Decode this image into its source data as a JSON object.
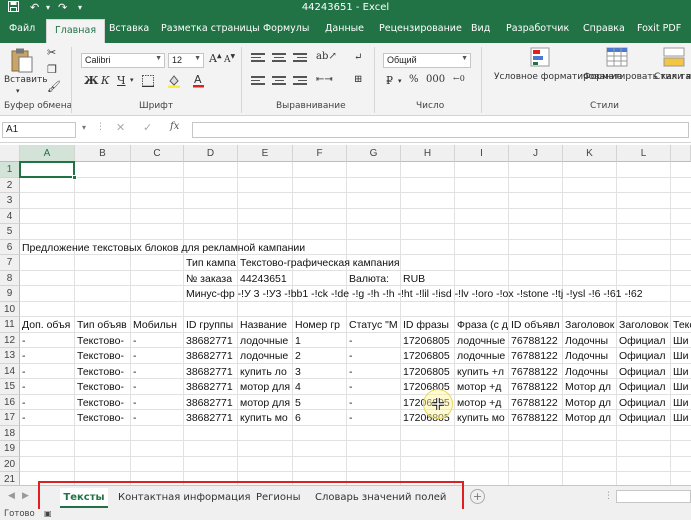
{
  "window": {
    "title": "44243651 - Excel"
  },
  "ribbon": {
    "tabs": [
      {
        "label": "Файл"
      },
      {
        "label": "Главная"
      },
      {
        "label": "Вставка"
      },
      {
        "label": "Разметка страницы"
      },
      {
        "label": "Формулы"
      },
      {
        "label": "Данные"
      },
      {
        "label": "Рецензирование"
      },
      {
        "label": "Вид"
      },
      {
        "label": "Разработчик"
      },
      {
        "label": "Справка"
      },
      {
        "label": "Foxit PDF"
      }
    ],
    "active_tab": "Главная",
    "paste_label": "Вставить",
    "font_name": "Calibri",
    "font_size": "12",
    "number_format": "Общий",
    "bold": "Ж",
    "italic": "К",
    "underline": "Ч",
    "currency_symbol": "₽",
    "cond_format_label": "Условное форматирование",
    "format_table_label": "Форматировать как таблицу",
    "cell_styles_label": "Стили ячеек",
    "groups": {
      "clipboard": "Буфер обмена",
      "font": "Шрифт",
      "alignment": "Выравнивание",
      "number": "Число",
      "styles": "Стили"
    }
  },
  "formula_bar": {
    "name_box": "A1",
    "fx": "fx",
    "value": ""
  },
  "grid": {
    "columns": [
      "A",
      "B",
      "C",
      "D",
      "E",
      "F",
      "G",
      "H",
      "I",
      "J",
      "K",
      "L"
    ],
    "rows": [
      "1",
      "2",
      "3",
      "4",
      "5",
      "6",
      "7",
      "8",
      "9",
      "10",
      "11",
      "12",
      "13",
      "14",
      "15",
      "16",
      "17",
      "18",
      "19",
      "20",
      "21"
    ],
    "cells": [
      {
        "row": 6,
        "col": "A",
        "text": "Предложение текстовых блоков для рекламной кампании"
      },
      {
        "row": 7,
        "col": "D",
        "text": "Тип кампа"
      },
      {
        "row": 7,
        "col": "E",
        "text": "Текстово-графическая кампания"
      },
      {
        "row": 8,
        "col": "D",
        "text": "№ заказа"
      },
      {
        "row": 8,
        "col": "E",
        "text": "44243651"
      },
      {
        "row": 8,
        "col": "G",
        "text": "Валюта:"
      },
      {
        "row": 8,
        "col": "H",
        "text": "RUB"
      },
      {
        "row": 9,
        "col": "D",
        "text": "Минус-фр -!У 3 -!У3 -!bb1 -!ck -!de -!g -!h -!h -!ht -!lil -!isd -!lv -!oro -!ox -!stone -!tj -!ysl -!6 -!61 -!62"
      },
      {
        "row": 11,
        "col": "A",
        "text": "Доп. объя"
      },
      {
        "row": 11,
        "col": "B",
        "text": "Тип объяв"
      },
      {
        "row": 11,
        "col": "C",
        "text": "Мобильн"
      },
      {
        "row": 11,
        "col": "D",
        "text": "ID группы"
      },
      {
        "row": 11,
        "col": "E",
        "text": "Название"
      },
      {
        "row": 11,
        "col": "F",
        "text": "Номер гр"
      },
      {
        "row": 11,
        "col": "G",
        "text": "Статус \"М"
      },
      {
        "row": 11,
        "col": "H",
        "text": "ID фразы"
      },
      {
        "row": 11,
        "col": "I",
        "text": "Фраза (с д"
      },
      {
        "row": 11,
        "col": "J",
        "text": "ID объявл"
      },
      {
        "row": 11,
        "col": "K",
        "text": "Заголовок"
      },
      {
        "row": 11,
        "col": "L",
        "text": "Заголовок"
      },
      {
        "row": 11,
        "col": "M",
        "text": "Текс"
      },
      {
        "row": 12,
        "col": "A",
        "text": "-"
      },
      {
        "row": 12,
        "col": "B",
        "text": "Текстово-"
      },
      {
        "row": 12,
        "col": "C",
        "text": "-"
      },
      {
        "row": 12,
        "col": "D",
        "text": "38682771"
      },
      {
        "row": 12,
        "col": "E",
        "text": "лодочные"
      },
      {
        "row": 12,
        "col": "F",
        "text": "1"
      },
      {
        "row": 12,
        "col": "G",
        "text": "-"
      },
      {
        "row": 12,
        "col": "H",
        "text": "17206805"
      },
      {
        "row": 12,
        "col": "I",
        "text": "лодочные"
      },
      {
        "row": 12,
        "col": "J",
        "text": "76788122"
      },
      {
        "row": 12,
        "col": "K",
        "text": "Лодочны"
      },
      {
        "row": 12,
        "col": "L",
        "text": "Официал"
      },
      {
        "row": 12,
        "col": "M",
        "text": "Ши"
      },
      {
        "row": 13,
        "col": "A",
        "text": "-"
      },
      {
        "row": 13,
        "col": "B",
        "text": "Текстово-"
      },
      {
        "row": 13,
        "col": "C",
        "text": "-"
      },
      {
        "row": 13,
        "col": "D",
        "text": "38682771"
      },
      {
        "row": 13,
        "col": "E",
        "text": "лодочные"
      },
      {
        "row": 13,
        "col": "F",
        "text": "2"
      },
      {
        "row": 13,
        "col": "G",
        "text": "-"
      },
      {
        "row": 13,
        "col": "H",
        "text": "17206805"
      },
      {
        "row": 13,
        "col": "I",
        "text": "лодочные"
      },
      {
        "row": 13,
        "col": "J",
        "text": "76788122"
      },
      {
        "row": 13,
        "col": "K",
        "text": "Лодочны"
      },
      {
        "row": 13,
        "col": "L",
        "text": "Официал"
      },
      {
        "row": 13,
        "col": "M",
        "text": "Ши"
      },
      {
        "row": 14,
        "col": "A",
        "text": "-"
      },
      {
        "row": 14,
        "col": "B",
        "text": "Текстово-"
      },
      {
        "row": 14,
        "col": "C",
        "text": "-"
      },
      {
        "row": 14,
        "col": "D",
        "text": "38682771"
      },
      {
        "row": 14,
        "col": "E",
        "text": "купить ло"
      },
      {
        "row": 14,
        "col": "F",
        "text": "3"
      },
      {
        "row": 14,
        "col": "G",
        "text": "-"
      },
      {
        "row": 14,
        "col": "H",
        "text": "17206805"
      },
      {
        "row": 14,
        "col": "I",
        "text": "купить +л"
      },
      {
        "row": 14,
        "col": "J",
        "text": "76788122"
      },
      {
        "row": 14,
        "col": "K",
        "text": "Лодочны"
      },
      {
        "row": 14,
        "col": "L",
        "text": "Официал"
      },
      {
        "row": 14,
        "col": "M",
        "text": "Ши"
      },
      {
        "row": 15,
        "col": "A",
        "text": "-"
      },
      {
        "row": 15,
        "col": "B",
        "text": "Текстово-"
      },
      {
        "row": 15,
        "col": "C",
        "text": "-"
      },
      {
        "row": 15,
        "col": "D",
        "text": "38682771"
      },
      {
        "row": 15,
        "col": "E",
        "text": "мотор для"
      },
      {
        "row": 15,
        "col": "F",
        "text": "4"
      },
      {
        "row": 15,
        "col": "G",
        "text": "-"
      },
      {
        "row": 15,
        "col": "H",
        "text": "17206805"
      },
      {
        "row": 15,
        "col": "I",
        "text": "мотор +д"
      },
      {
        "row": 15,
        "col": "J",
        "text": "76788122"
      },
      {
        "row": 15,
        "col": "K",
        "text": "Мотор дл"
      },
      {
        "row": 15,
        "col": "L",
        "text": "Официал"
      },
      {
        "row": 15,
        "col": "M",
        "text": "Ши"
      },
      {
        "row": 16,
        "col": "A",
        "text": "-"
      },
      {
        "row": 16,
        "col": "B",
        "text": "Текстово-"
      },
      {
        "row": 16,
        "col": "C",
        "text": "-"
      },
      {
        "row": 16,
        "col": "D",
        "text": "38682771"
      },
      {
        "row": 16,
        "col": "E",
        "text": "мотор для"
      },
      {
        "row": 16,
        "col": "F",
        "text": "5"
      },
      {
        "row": 16,
        "col": "G",
        "text": "-"
      },
      {
        "row": 16,
        "col": "H",
        "text": "17206805"
      },
      {
        "row": 16,
        "col": "I",
        "text": "мотор +д"
      },
      {
        "row": 16,
        "col": "J",
        "text": "76788122"
      },
      {
        "row": 16,
        "col": "K",
        "text": "Мотор дл"
      },
      {
        "row": 16,
        "col": "L",
        "text": "Официал"
      },
      {
        "row": 16,
        "col": "M",
        "text": "Ши"
      },
      {
        "row": 17,
        "col": "A",
        "text": "-"
      },
      {
        "row": 17,
        "col": "B",
        "text": "Текстово-"
      },
      {
        "row": 17,
        "col": "C",
        "text": "-"
      },
      {
        "row": 17,
        "col": "D",
        "text": "38682771"
      },
      {
        "row": 17,
        "col": "E",
        "text": "купить мо"
      },
      {
        "row": 17,
        "col": "F",
        "text": "6"
      },
      {
        "row": 17,
        "col": "G",
        "text": "-"
      },
      {
        "row": 17,
        "col": "H",
        "text": "17206805"
      },
      {
        "row": 17,
        "col": "I",
        "text": "купить мо"
      },
      {
        "row": 17,
        "col": "J",
        "text": "76788122"
      },
      {
        "row": 17,
        "col": "K",
        "text": "Мотор дл"
      },
      {
        "row": 17,
        "col": "L",
        "text": "Официал"
      },
      {
        "row": 17,
        "col": "M",
        "text": "Ши"
      }
    ]
  },
  "sheets": [
    {
      "label": "Тексты",
      "active": true
    },
    {
      "label": "Контактная информация",
      "active": false
    },
    {
      "label": "Регионы",
      "active": false
    },
    {
      "label": "Словарь значений полей",
      "active": false
    }
  ],
  "status": {
    "text": "Готово"
  },
  "colors": {
    "accent": "#217346",
    "highlight": "#e02020"
  },
  "icons": [
    "save-icon",
    "undo-icon",
    "redo-icon",
    "paste-icon",
    "cut-icon",
    "copy-icon",
    "format-painter-icon",
    "add-sheet-icon",
    "cursor-icon"
  ]
}
